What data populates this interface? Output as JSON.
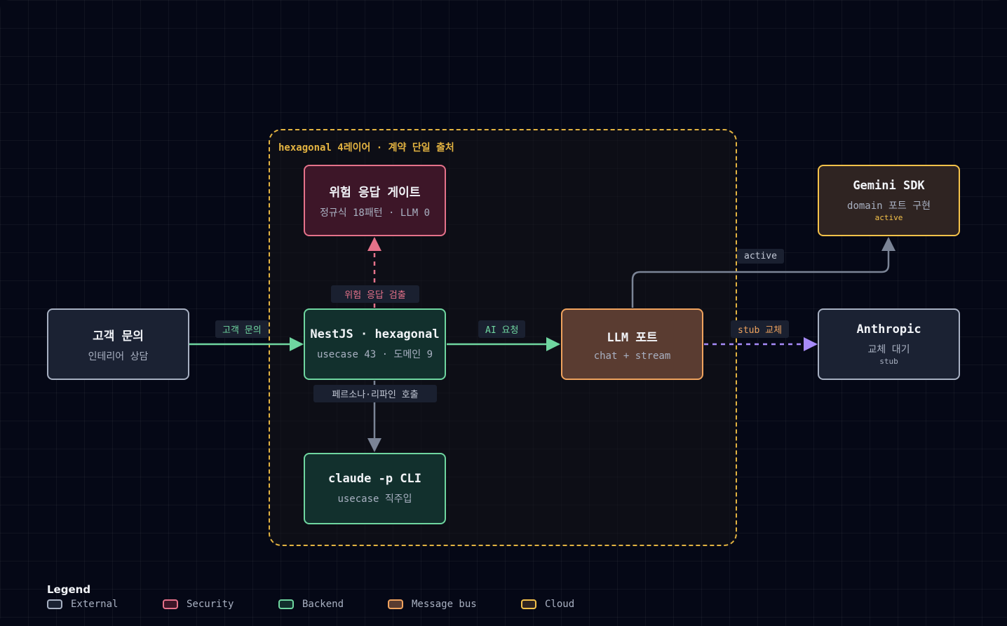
{
  "diagram": {
    "boundary_label": "hexagonal 4레이어 · 계약 단일 출처",
    "nodes": {
      "customer": {
        "title": "고객 문의",
        "sub": "인테리어 상담"
      },
      "risk_gate": {
        "title": "위험 응답 게이트",
        "sub": "정규식 18패턴 · LLM 0"
      },
      "nestjs": {
        "title": "NestJS · hexagonal",
        "sub": "usecase 43 · 도메인 9"
      },
      "claude_cli": {
        "title": "claude -p CLI",
        "sub": "usecase 직주입"
      },
      "llm_port": {
        "title": "LLM 포트",
        "sub": "chat + stream"
      },
      "gemini": {
        "title": "Gemini SDK",
        "sub": "domain 포트 구현",
        "tag": "active"
      },
      "anthropic": {
        "title": "Anthropic",
        "sub": "교체 대기",
        "tag": "stub"
      }
    },
    "edges": {
      "customer_to_nestjs": "고객 문의",
      "nestjs_to_risk": "위험 응답 검출",
      "nestjs_to_claude": "페르소나·리파인 호출",
      "nestjs_to_llm": "AI 요청",
      "llm_to_gemini": "active",
      "llm_to_anthropic": "stub 교체"
    }
  },
  "legend": {
    "title": "Legend",
    "items": [
      {
        "label": "External",
        "color": "#a7b0c2"
      },
      {
        "label": "Security",
        "color": "#e5728a"
      },
      {
        "label": "Backend",
        "color": "#6fd6a0"
      },
      {
        "label": "Message bus",
        "color": "#f0a35e"
      },
      {
        "label": "Cloud",
        "color": "#f5c24a"
      }
    ]
  },
  "colors": {
    "external": "#a7b0c2",
    "security": "#e5728a",
    "backend": "#6fd6a0",
    "message_bus": "#f0a35e",
    "cloud": "#f5c24a",
    "stub_edge": "#a78bfa",
    "neutral_edge": "#7b8496"
  }
}
